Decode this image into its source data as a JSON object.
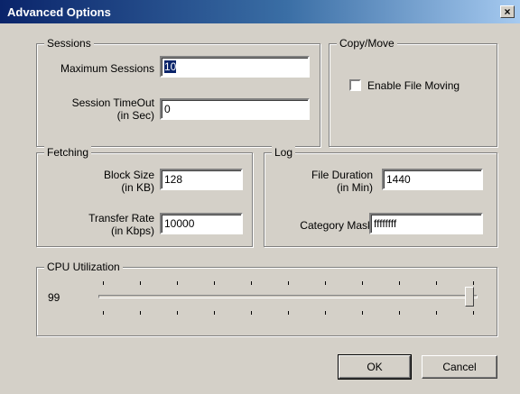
{
  "window": {
    "title": "Advanced Options",
    "close_label": "×"
  },
  "sessions": {
    "legend": "Sessions",
    "max_label": "Maximum Sessions",
    "max_value": "10",
    "timeout_label_1": "Session TimeOut",
    "timeout_label_2": "(in Sec)",
    "timeout_value": "0"
  },
  "copy_move": {
    "legend": "Copy/Move",
    "enable_label": "Enable File Moving",
    "enable_checked": false
  },
  "fetching": {
    "legend": "Fetching",
    "block_label_1": "Block Size",
    "block_label_2": "(in KB)",
    "block_value": "128",
    "rate_label_1": "Transfer Rate",
    "rate_label_2": "(in Kbps)",
    "rate_value": "10000"
  },
  "log": {
    "legend": "Log",
    "duration_label_1": "File Duration",
    "duration_label_2": "(in Min)",
    "duration_value": "1440",
    "mask_label": "Category Mask",
    "mask_value": "ffffffff"
  },
  "cpu": {
    "legend": "CPU Utilization",
    "value": "99",
    "min": 0,
    "max": 100,
    "level": 99
  },
  "buttons": {
    "ok": "OK",
    "cancel": "Cancel"
  }
}
